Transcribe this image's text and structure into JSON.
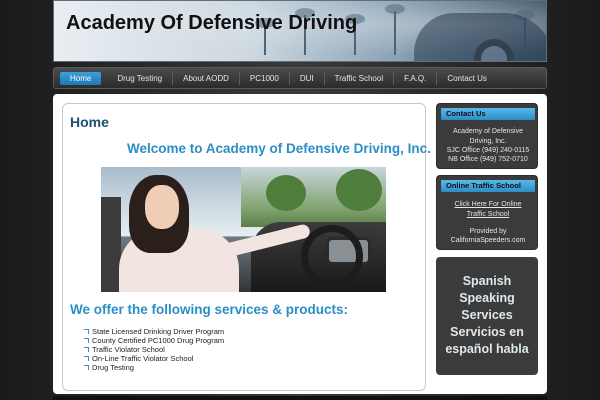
{
  "header": {
    "title": "Academy Of Defensive Driving"
  },
  "nav": {
    "items": [
      "Home",
      "Drug Testing",
      "About AODD",
      "PC1000",
      "DUI",
      "Traffic School",
      "F.A.Q.",
      "Contact Us"
    ],
    "active": "Home"
  },
  "main": {
    "title": "Home",
    "welcome": "Welcome to Academy of Defensive Driving, Inc.",
    "services_title": "We offer the following services & products:",
    "services": [
      "State Licensed Drinking Driver Program",
      "County Certified PC1000 Drug Program",
      "Traffic Violator School",
      "On-Line Traffic Violator School",
      "Drug Testing"
    ]
  },
  "sidebar": {
    "contact": {
      "heading": "Contact Us",
      "company": "Academy of Defensive Driving, Inc.",
      "sjc": "SJC Office (949) 240-0115",
      "nb": "NB Office (949) 752-0710"
    },
    "online": {
      "heading": "Online Traffic School",
      "link": "Click Here For Online Traffic School",
      "provided": "Provided by",
      "provider": "CaliforniaSpeeders.com"
    },
    "spanish": {
      "lines": [
        "Spanish",
        "Speaking",
        "Services",
        "Servicios en",
        "español habla"
      ]
    }
  },
  "colors": {
    "accent": "#2b8fc6",
    "title_dark": "#1d4f6e",
    "nav_active": "#2a8bcc",
    "widget_bg": "#3b3b3b"
  }
}
